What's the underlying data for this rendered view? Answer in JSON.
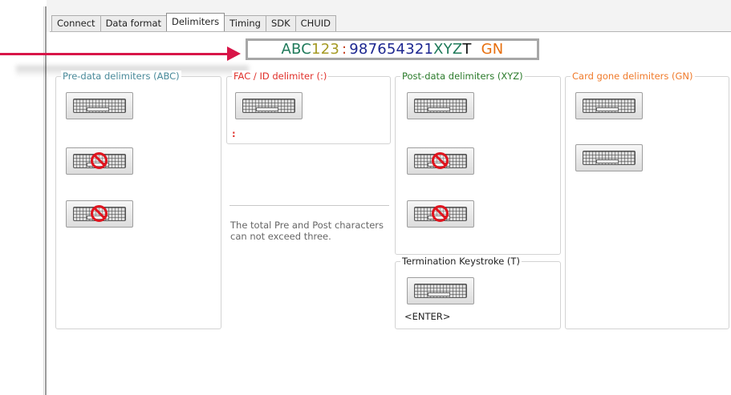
{
  "tabs": [
    "Connect",
    "Data format",
    "Delimiters",
    "Timing",
    "SDK",
    "CHUID"
  ],
  "active_tab": "Delimiters",
  "banner": [
    {
      "text": "ABC",
      "color": "#1f7a5a"
    },
    {
      "text": "123",
      "color": "#a59a24"
    },
    {
      "text": ":",
      "color": "#c43a1a"
    },
    {
      "text": "987654321",
      "color": "#1d2790"
    },
    {
      "text": "XYZ",
      "color": "#1f7a5a"
    },
    {
      "text": "T",
      "color": "#111111"
    },
    {
      "text": "GN",
      "color": "#e8700f"
    }
  ],
  "groups": {
    "pre": {
      "label": "Pre-data delimiters (ABC)",
      "color": "#4a8a9a"
    },
    "fac": {
      "label": "FAC / ID delimiter (:)",
      "color": "#e0302a",
      "value": ":"
    },
    "post": {
      "label": "Post-data delimiters (XYZ)",
      "color": "#2a7a2a"
    },
    "gone": {
      "label": "Card gone delimiters (GN)",
      "color": "#f07a2a"
    },
    "term": {
      "label": "Termination Keystroke (T)",
      "color": "#222222",
      "value": "<ENTER>"
    }
  },
  "note": "The total Pre and Post characters can not exceed three.",
  "icons": {
    "keyboard": "keyboard-icon",
    "none": "no-entry-icon"
  }
}
